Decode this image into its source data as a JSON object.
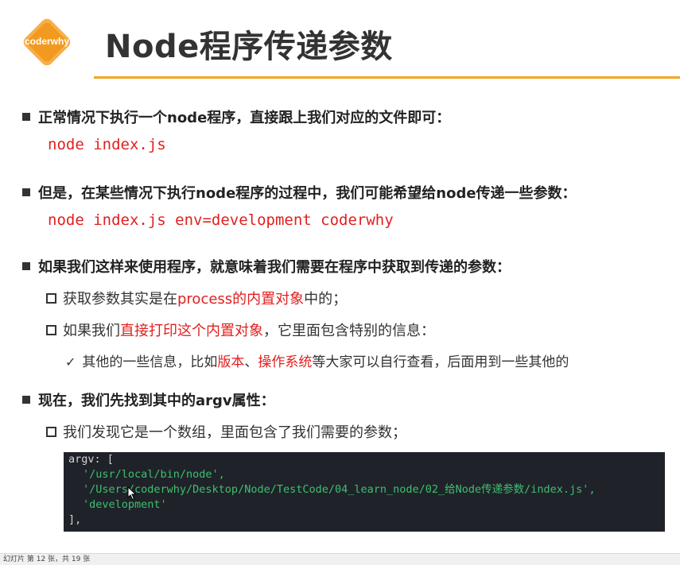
{
  "slide": {
    "logo_text": "coderwhy",
    "title": "Node程序传递参数",
    "accent_color": "#f5a623",
    "highlight_color": "#e02020"
  },
  "b1": {
    "text": "正常情况下执行一个node程序，直接跟上我们对应的文件即可：",
    "code": "node index.js"
  },
  "b2": {
    "text": "但是，在某些情况下执行node程序的过程中，我们可能希望给node传递一些参数：",
    "code": "node index.js env=development coderwhy"
  },
  "b3": {
    "text": "如果我们这样来使用程序，就意味着我们需要在程序中获取到传递的参数：",
    "sub1_a": "获取参数其实是在",
    "sub1_red": "process的内置对象",
    "sub1_b": "中的；",
    "sub2_a": "如果我们",
    "sub2_red": "直接打印这个内置对象",
    "sub2_b": "，它里面包含特别的信息：",
    "sub3_a": "其他的一些信息，比如",
    "sub3_red1": "版本",
    "sub3_sep": "、",
    "sub3_red2": "操作系统",
    "sub3_b": "等大家可以自行查看，后面用到一些其他的"
  },
  "b4": {
    "text": "现在，我们先找到其中的argv属性：",
    "sub1": "我们发现它是一个数组，里面包含了我们需要的参数；"
  },
  "terminal": {
    "line1": "argv: [",
    "line2": "'/usr/local/bin/node',",
    "line3": "'/Users/coderwhy/Desktop/Node/TestCode/04_learn_node/02_给Node传递参数/index.js',",
    "line4": "'development'",
    "line5": "],"
  },
  "status": {
    "text": "幻灯片 第 12 张，共 19 张"
  }
}
